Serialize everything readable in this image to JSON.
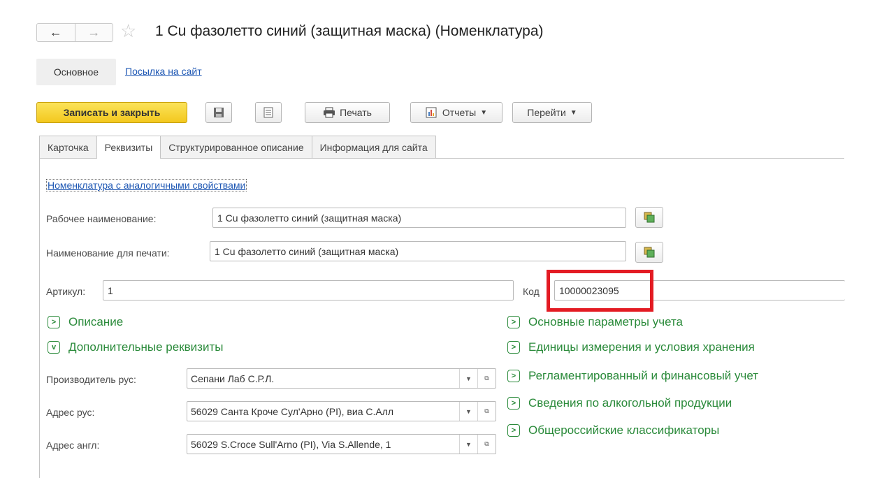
{
  "window": {
    "title": "1 Cu фазолетто синий  (защитная маска) (Номенклатура)",
    "nav_back": "←",
    "nav_forward": "→",
    "favorite_icon": "star-icon"
  },
  "panel": {
    "main": "Основное",
    "link": "Посылка на сайт"
  },
  "toolbar": {
    "save_close": "Записать и закрыть",
    "print": "Печать",
    "reports": "Отчеты",
    "goto": "Перейти"
  },
  "tabs": [
    {
      "label": "Карточка"
    },
    {
      "label": "Реквизиты"
    },
    {
      "label": "Структурированное описание"
    },
    {
      "label": "Информация для сайта"
    }
  ],
  "form": {
    "similar_link": "Номенклатура с аналогичными свойствами",
    "work_name_label": "Рабочее наименование:",
    "work_name_value": "1 Cu фазолетто синий  (защитная маска)",
    "print_name_label": "Наименование для печати:",
    "print_name_value": "1 Cu фазолетто синий  (защитная маска)",
    "article_label": "Артикул:",
    "article_value": "1",
    "code_label": "Код",
    "code_value": "10000023095"
  },
  "groups_left": [
    {
      "label": "Описание",
      "expanded": false
    },
    {
      "label": "Дополнительные реквизиты",
      "expanded": true
    }
  ],
  "groups_right": [
    {
      "label": "Основные параметры учета"
    },
    {
      "label": "Единицы измерения и условия хранения"
    },
    {
      "label": "Регламентированный и финансовый учет"
    },
    {
      "label": "Сведения по алкогольной продукции"
    },
    {
      "label": "Общероссийские классификаторы"
    }
  ],
  "extra": {
    "manufacturer_label": "Производитель рус:",
    "manufacturer_value": "Сепани Лаб С.Р.Л.",
    "address_ru_label": "Адрес рус:",
    "address_ru_value": "56029 Санта Кроче Сул'Арно (PI), виа С.Алл",
    "address_en_label": "Адрес англ:",
    "address_en_value": "56029 S.Croce Sull'Arno (PI), Via S.Allende, 1"
  },
  "colors": {
    "accent_yellow": "#f3c81e",
    "group_green": "#2a8a3a",
    "link_blue": "#1f58b4",
    "highlight_red": "#e31b23"
  }
}
